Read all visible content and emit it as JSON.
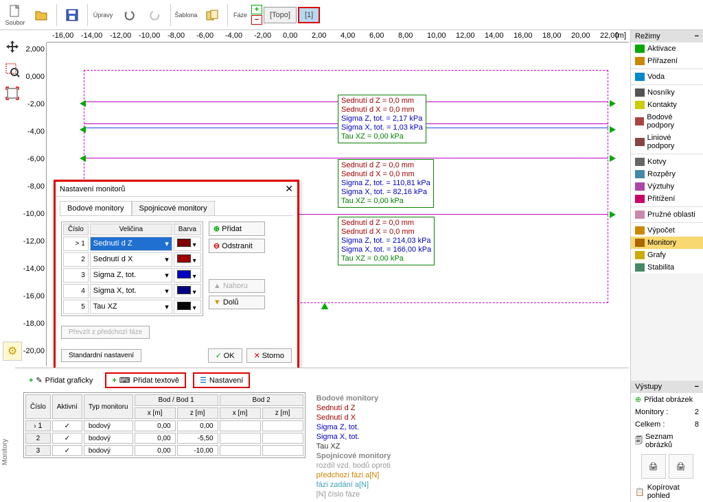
{
  "toolbar": {
    "soubor": "Soubor",
    "upravy": "Úpravy",
    "sablona": "Šablona",
    "faze": "Fáze",
    "topo": "[Topo]",
    "phase1": "[1]"
  },
  "ruler_unit": "[m]",
  "ruler_x": [
    "-16,00",
    "-14,00",
    "-12,00",
    "-10,00",
    "-8,00",
    "-6,00",
    "-4,00",
    "-2,00",
    "0,00",
    "2,00",
    "4,00",
    "6,00",
    "8,00",
    "10,00",
    "12,00",
    "14,00",
    "16,00",
    "18,00",
    "20,00",
    "22,00"
  ],
  "ruler_z": [
    "2,000",
    "0,000",
    "-2,00",
    "-4,00",
    "-6,00",
    "-8,00",
    "-10,00",
    "-12,00",
    "-14,00",
    "-16,00",
    "-18,00",
    "-20,00"
  ],
  "monitors": [
    {
      "dz": "Sednutí d Z = 0,0 mm",
      "dx": "Sednutí d X = 0,0 mm",
      "sz": "Sigma Z, tot. = 2,17 kPa",
      "sx": "Sigma X, tot. = 1,03 kPa",
      "tau": "Tau XZ = 0,00 kPa"
    },
    {
      "dz": "Sednutí d Z = 0,0 mm",
      "dx": "Sednutí d X = 0,0 mm",
      "sz": "Sigma Z, tot. = 110,81 kPa",
      "sx": "Sigma X, tot. = 82,16 kPa",
      "tau": "Tau XZ = 0,00 kPa"
    },
    {
      "dz": "Sednutí d Z = 0,0 mm",
      "dx": "Sednutí d X = 0,0 mm",
      "sz": "Sigma Z, tot. = 214,03 kPa",
      "sx": "Sigma X, tot. = 166,00 kPa",
      "tau": "Tau XZ = 0,00 kPa"
    }
  ],
  "dialog": {
    "title": "Nastavení monitorů",
    "tab1": "Bodové monitory",
    "tab2": "Spojnicové monitory",
    "col_num": "Číslo",
    "col_qty": "Veličina",
    "col_color": "Barva",
    "rows": [
      {
        "n": "> 1",
        "q": "Sednutí d Z",
        "c": "#800000"
      },
      {
        "n": "2",
        "q": "Sednutí d X",
        "c": "#a00000"
      },
      {
        "n": "3",
        "q": "Sigma Z, tot.",
        "c": "#0000c0"
      },
      {
        "n": "4",
        "q": "Sigma X, tot.",
        "c": "#000080"
      },
      {
        "n": "5",
        "q": "Tau XZ",
        "c": "#000000"
      }
    ],
    "add": "Přidat",
    "remove": "Odstranit",
    "up": "Nahoru",
    "down": "Dolů",
    "prev_phase": "Převzít z předchozí fáze",
    "std": "Standardní nastavení",
    "ok": "OK",
    "cancel": "Storno"
  },
  "modes": {
    "header": "Režimy",
    "items": [
      "Aktivace",
      "Přiřazení",
      "Voda",
      "Nosníky",
      "Kontakty",
      "Bodové podpory",
      "Liniové podpory",
      "Kotvy",
      "Rozpěry",
      "Výztuhy",
      "Přitížení",
      "Pružné oblasti",
      "Výpočet",
      "Monitory",
      "Grafy",
      "Stabilita"
    ]
  },
  "outputs": {
    "header": "Výstupy",
    "add_pic": "Přidat obrázek",
    "mon_label": "Monitory :",
    "mon_val": "2",
    "total_label": "Celkem :",
    "total_val": "8",
    "list": "Seznam obrázků",
    "copy": "Kopírovat pohled"
  },
  "bottom": {
    "add_gfx": "Přidat graficky",
    "add_txt": "Přidat textově",
    "settings": "Nastavení",
    "cols": {
      "num": "Číslo",
      "active": "Aktivní",
      "type": "Typ monitoru",
      "pt1": "Bod / Bod 1",
      "pt2": "Bod 2",
      "x": "x [m]",
      "z": "z [m]"
    },
    "rows": [
      {
        "n": "1",
        "type": "bodový",
        "x1": "0,00",
        "z1": "0,00"
      },
      {
        "n": "2",
        "type": "bodový",
        "x1": "0,00",
        "z1": "-5,50"
      },
      {
        "n": "3",
        "type": "bodový",
        "x1": "0,00",
        "z1": "-10,00"
      }
    ],
    "legend": {
      "h1": "Bodové monitory",
      "l1": "Sednutí d Z",
      "l2": "Sednutí d X",
      "l3": "Sigma Z, tot.",
      "l4": "Sigma X, tot.",
      "l5": "Tau XZ",
      "h2": "Spojnicové monitory",
      "g1": "rozdíl vzd. bodů oproti",
      "g2": "předchozí fázi a[N]",
      "g3": "fázi zadání a[N]",
      "g4": "[N] číslo fáze"
    }
  },
  "side_label": "Monitory"
}
